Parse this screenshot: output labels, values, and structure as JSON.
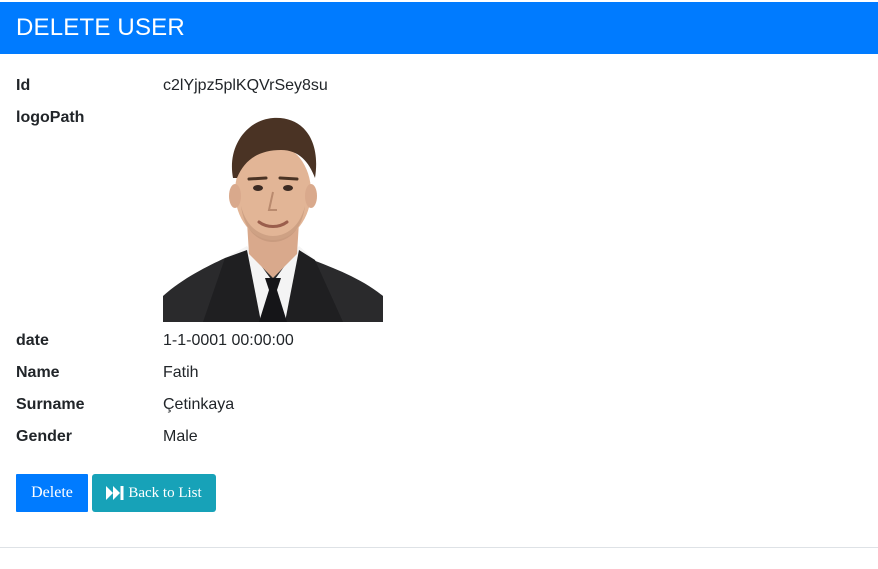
{
  "header": {
    "title": "DELETE USER"
  },
  "details": {
    "id": {
      "label": "Id",
      "value": "c2lYjpz5plKQVrSey8su"
    },
    "logoPath": {
      "label": "logoPath"
    },
    "date": {
      "label": "date",
      "value": "1-1-0001 00:00:00"
    },
    "name": {
      "label": "Name",
      "value": "Fatih"
    },
    "surname": {
      "label": "Surname",
      "value": "Çetinkaya"
    },
    "gender": {
      "label": "Gender",
      "value": "Male"
    }
  },
  "actions": {
    "delete_label": "Delete",
    "back_label": "Back to List",
    "back_icon": "fast-forward-icon"
  },
  "colors": {
    "primary": "#007bff",
    "info": "#17a2b8",
    "text": "#212529",
    "divider": "#dee2e6"
  }
}
